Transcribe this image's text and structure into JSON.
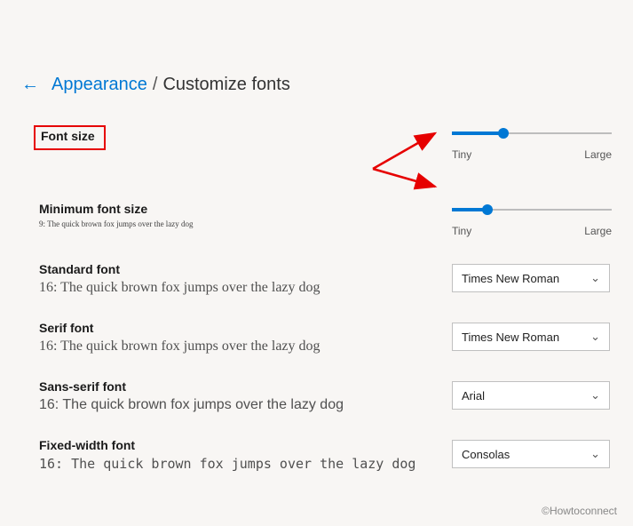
{
  "breadcrumb": {
    "back_link": "Appearance",
    "separator": "/",
    "current": "Customize fonts"
  },
  "sections": {
    "font_size": {
      "label": "Font size",
      "slider": {
        "min_label": "Tiny",
        "max_label": "Large",
        "percent": 32
      }
    },
    "min_font_size": {
      "label": "Minimum font size",
      "sample": "9: The quick brown fox jumps over the lazy dog",
      "slider": {
        "min_label": "Tiny",
        "max_label": "Large",
        "percent": 22
      }
    },
    "standard": {
      "label": "Standard font",
      "sample": "16: The quick brown fox jumps over the lazy dog",
      "value": "Times New Roman"
    },
    "serif": {
      "label": "Serif font",
      "sample": "16: The quick brown fox jumps over the lazy dog",
      "value": "Times New Roman"
    },
    "sans": {
      "label": "Sans-serif font",
      "sample": "16: The quick brown fox jumps over the lazy dog",
      "value": "Arial"
    },
    "mono": {
      "label": "Fixed-width font",
      "sample": "16: The quick brown fox jumps over the lazy dog",
      "value": "Consolas"
    }
  },
  "watermark": "©Howtoconnect"
}
